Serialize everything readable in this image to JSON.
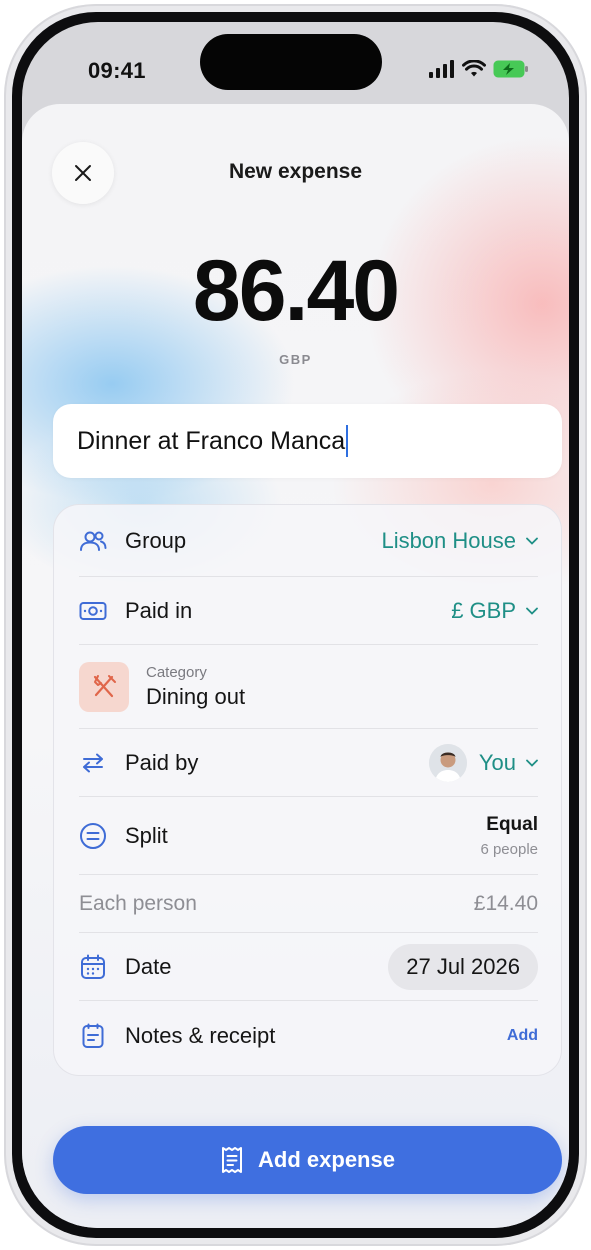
{
  "status_bar": {
    "time": "09:41",
    "icons": [
      "cellular-signal-icon",
      "wifi-icon",
      "battery-charging-icon"
    ]
  },
  "header": {
    "title": "New expense",
    "close_icon": "close-icon"
  },
  "amount": {
    "value": "86.40",
    "currency_code": "GBP"
  },
  "description": {
    "value": "Dinner at Franco Manca"
  },
  "details": {
    "group": {
      "label": "Group",
      "value": "Lisbon House",
      "icon": "group-icon"
    },
    "paid_in": {
      "label": "Paid in",
      "value": "£ GBP",
      "icon": "cash-icon"
    },
    "category": {
      "label": "Category",
      "value": "Dining out",
      "icon": "fork-knife-icon"
    },
    "paid_by": {
      "label": "Paid by",
      "value": "You",
      "icon": "swap-arrows-icon"
    },
    "split": {
      "label": "Split",
      "value": "Equal",
      "sub": "6 people",
      "icon": "equal-circle-icon"
    },
    "each_person": {
      "label": "Each person",
      "value": "£14.40"
    },
    "date": {
      "label": "Date",
      "value": "27 Jul 2026",
      "icon": "calendar-icon"
    },
    "notes": {
      "label": "Notes & receipt",
      "action": "Add",
      "icon": "notes-icon"
    }
  },
  "cta": {
    "label": "Add expense",
    "icon": "receipt-icon"
  },
  "colors": {
    "accent": "#3f6fe0",
    "teal": "#1f8f86",
    "category_tile": "#f6d7cf",
    "icon_blue": "#3f6cd6"
  }
}
